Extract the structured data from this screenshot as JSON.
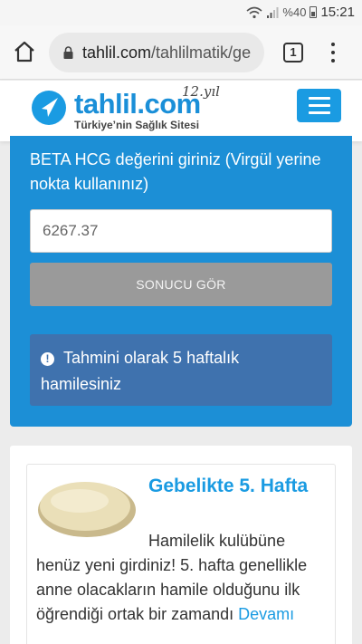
{
  "status_bar": {
    "battery_percent": "%40",
    "time": "15:21"
  },
  "browser": {
    "url_host": "tahlil.com",
    "url_path": "/tahlilmatik/ge",
    "tab_count": "1"
  },
  "site": {
    "logo_text": "tahlil.com",
    "logo_badge": "12.yıl",
    "tagline": "Türkiye’nin Sağlık Sitesi"
  },
  "calculator": {
    "label": "BETA HCG değerini giriniz (Virgül yerine nokta kullanınız)",
    "input_value": "6267.37",
    "button_label": "SONUCU GÖR",
    "result_text": "Tahmini olarak 5 haftalık hamilesiniz"
  },
  "article": {
    "title": "Gebelikte 5. Hafta",
    "body": "Hamilelik kulübüne henüz yeni girdiniz! 5. hafta genellikle anne olacakların hamile olduğunu ilk  öğrendiği ortak bir zamandı",
    "more_label": "Devamı"
  },
  "colors": {
    "brand_blue": "#1a9be2",
    "card_blue": "#1c8fd6",
    "result_blue": "#3f72ae",
    "button_gray": "#9a9a9a"
  },
  "icons": [
    "wifi-icon",
    "signal-icon",
    "battery-icon",
    "home-icon",
    "lock-icon",
    "tabs-icon",
    "more-vert-icon",
    "logo-icon",
    "hamburger-menu-icon",
    "info-icon"
  ]
}
